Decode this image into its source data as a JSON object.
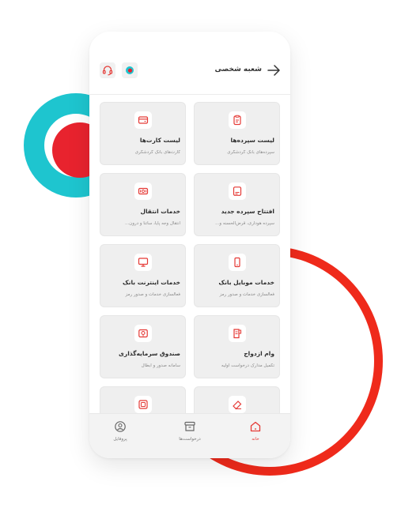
{
  "header": {
    "title": "شعبه شخصی"
  },
  "cards": [
    {
      "title": "لیست سپرده‌ها",
      "subtitle": "سپرده‌های بانک گردشگری",
      "icon": "deposit-list-icon"
    },
    {
      "title": "لیست کارت‌ها",
      "subtitle": "کارت‌های بانک گردشگری",
      "icon": "card-list-icon"
    },
    {
      "title": "افتتاح سپرده جدید",
      "subtitle": "سپرده هوداری، قرض‌الحسنه و...",
      "icon": "new-deposit-icon"
    },
    {
      "title": "خدمات انتقال",
      "subtitle": "انتقال وجه پایا، ساتنا و درون...",
      "icon": "transfer-icon"
    },
    {
      "title": "خدمات موبایل بانک",
      "subtitle": "فعالسازی خدمات و صدور رمز",
      "icon": "mobile-bank-icon"
    },
    {
      "title": "خدمات اینترنت بانک",
      "subtitle": "فعالسازی خدمات و صدور رمز",
      "icon": "internet-bank-icon"
    },
    {
      "title": "وام ازدواج",
      "subtitle": "تکمیل مدارک درخواست اولیه",
      "icon": "marriage-loan-icon"
    },
    {
      "title": "صندوق سرمایه‌گذاری",
      "subtitle": "سامانه صدور و ابطال",
      "icon": "investment-fund-icon"
    },
    {
      "title": "",
      "subtitle": "",
      "icon": "cheque-icon"
    },
    {
      "title": "",
      "subtitle": "",
      "icon": "box-icon"
    }
  ],
  "nav": [
    {
      "label": "خانه",
      "icon": "home-icon",
      "active": true
    },
    {
      "label": "درخواست‌ها",
      "icon": "requests-icon",
      "active": false
    },
    {
      "label": "پروفایل",
      "icon": "profile-icon",
      "active": false
    }
  ],
  "colors": {
    "accent": "#e53935",
    "teal": "#1ec5cf",
    "red_ring": "#ef2a1b",
    "card_bg": "#efefef"
  }
}
